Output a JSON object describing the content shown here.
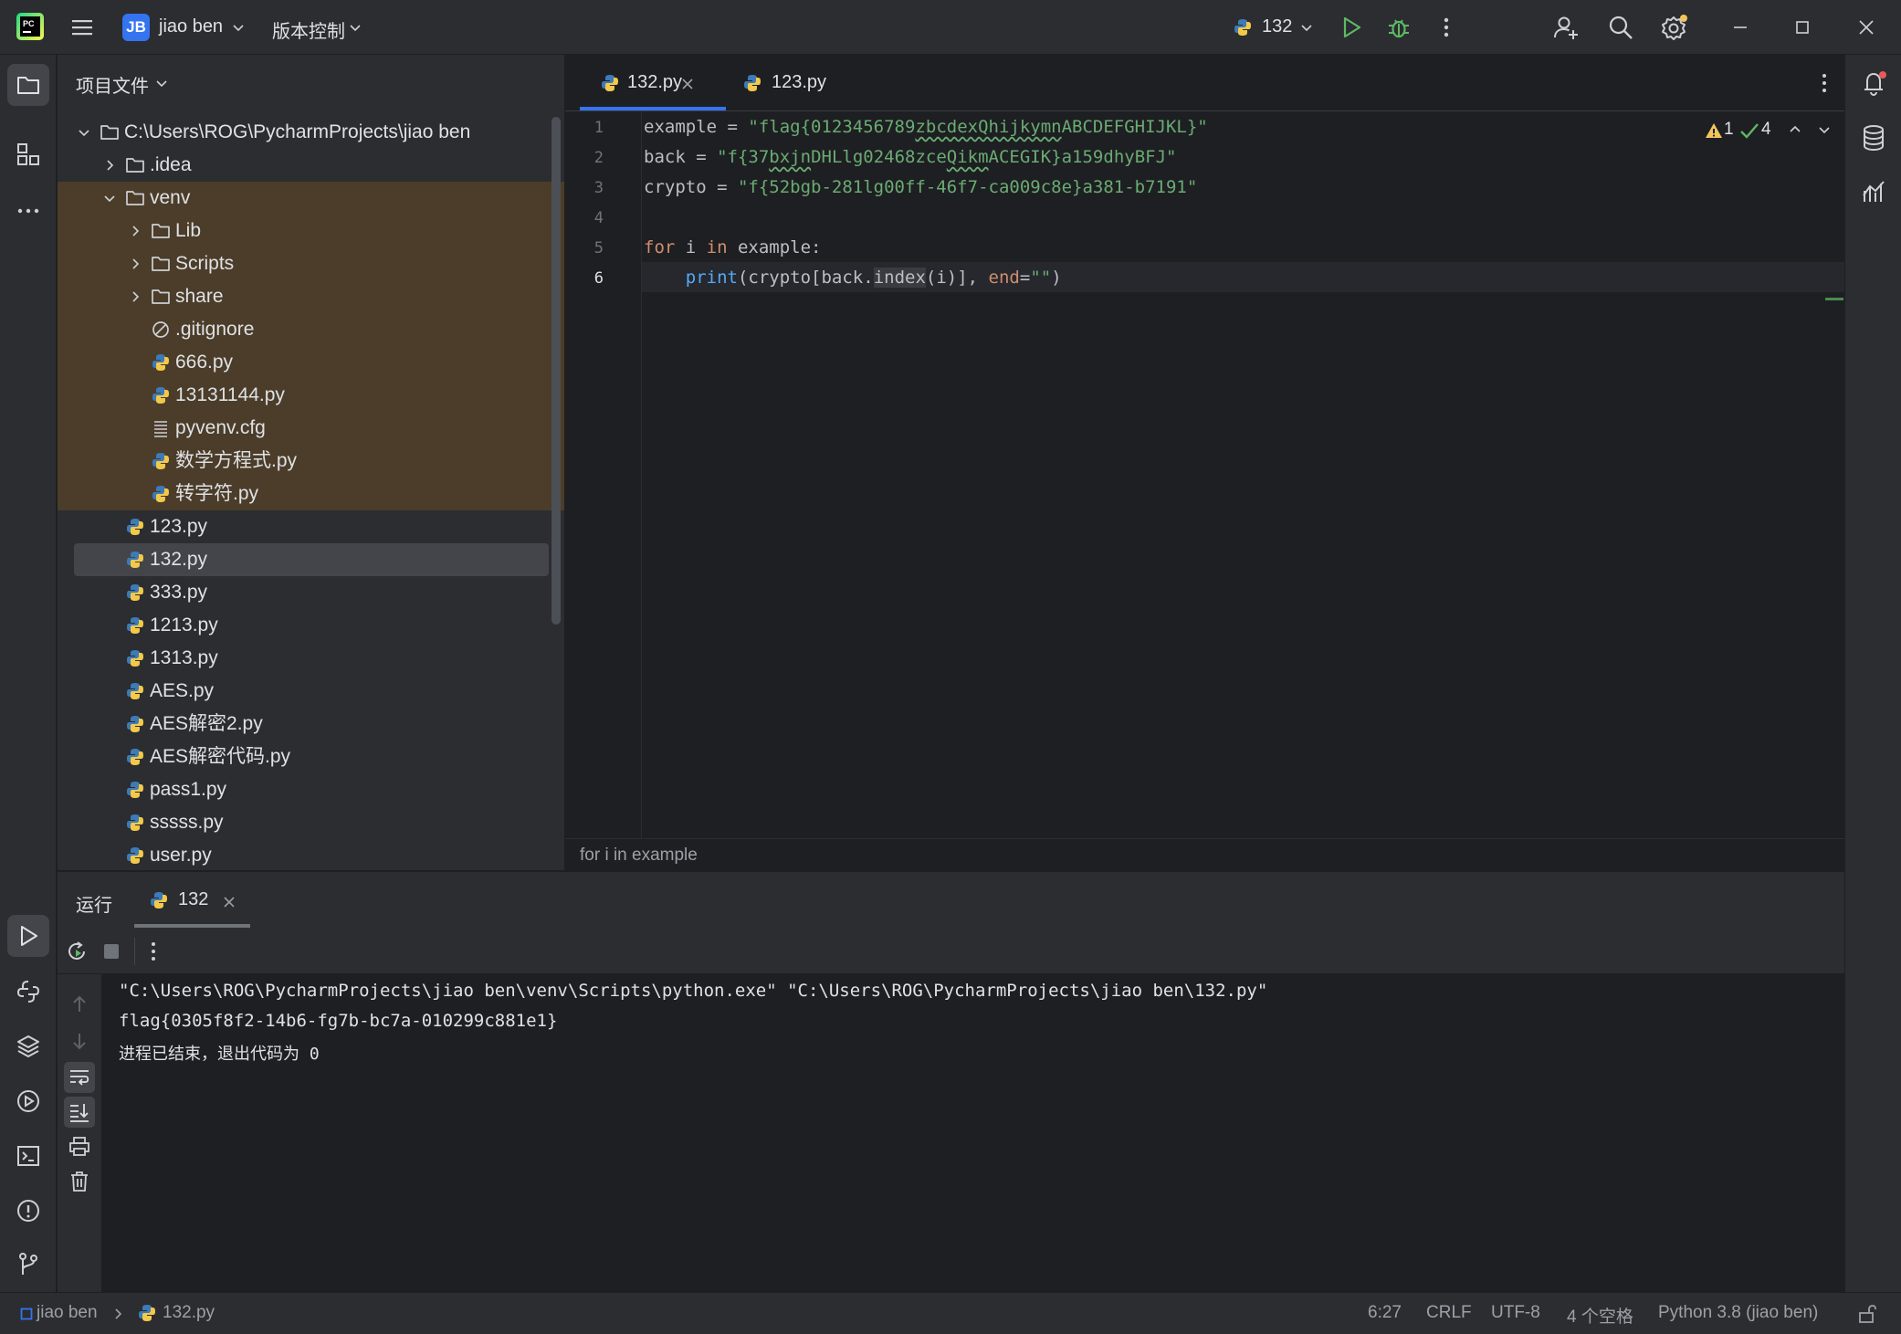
{
  "titlebar": {
    "project_badge": "JB",
    "project_name": "jiao ben",
    "vcs_label": "版本控制",
    "run_config": "132",
    "brand_color": "#3574f0"
  },
  "project_panel": {
    "title": "项目文件",
    "tree": [
      {
        "label": "C:\\Users\\ROG\\PycharmProjects\\jiao ben",
        "type": "folder",
        "depth": 0,
        "expanded": true
      },
      {
        "label": ".idea",
        "type": "folder",
        "depth": 1,
        "expanded": false
      },
      {
        "label": "venv",
        "type": "folder",
        "depth": 1,
        "expanded": true
      },
      {
        "label": "Lib",
        "type": "folder",
        "depth": 2,
        "expanded": false
      },
      {
        "label": "Scripts",
        "type": "folder",
        "depth": 2,
        "expanded": false
      },
      {
        "label": "share",
        "type": "folder",
        "depth": 2,
        "expanded": false
      },
      {
        "label": ".gitignore",
        "type": "ignore",
        "depth": 2
      },
      {
        "label": "666.py",
        "type": "python",
        "depth": 2
      },
      {
        "label": "13131144.py",
        "type": "python",
        "depth": 2
      },
      {
        "label": "pyvenv.cfg",
        "type": "text",
        "depth": 2
      },
      {
        "label": "数学方程式.py",
        "type": "python",
        "depth": 2
      },
      {
        "label": "转字符.py",
        "type": "python",
        "depth": 2
      },
      {
        "label": "123.py",
        "type": "python",
        "depth": 1
      },
      {
        "label": "132.py",
        "type": "python",
        "depth": 1,
        "selected": true
      },
      {
        "label": "333.py",
        "type": "python",
        "depth": 1
      },
      {
        "label": "1213.py",
        "type": "python",
        "depth": 1
      },
      {
        "label": "1313.py",
        "type": "python",
        "depth": 1
      },
      {
        "label": "AES.py",
        "type": "python",
        "depth": 1
      },
      {
        "label": "AES解密2.py",
        "type": "python",
        "depth": 1
      },
      {
        "label": "AES解密代码.py",
        "type": "python",
        "depth": 1
      },
      {
        "label": "pass1.py",
        "type": "python",
        "depth": 1
      },
      {
        "label": "sssss.py",
        "type": "python",
        "depth": 1
      },
      {
        "label": "user.py",
        "type": "python",
        "depth": 1
      }
    ]
  },
  "editor": {
    "tabs": [
      {
        "label": "132.py",
        "active": true
      },
      {
        "label": "123.py",
        "active": false
      }
    ],
    "inspections": {
      "warnings": "1",
      "ok": "4"
    },
    "line_numbers": [
      "1",
      "2",
      "3",
      "4",
      "5",
      "6"
    ],
    "code": {
      "l1_var": "example",
      "l1_eq": " = ",
      "l1_str_a": "\"flag{0123456789",
      "l1_str_b": "zbcdexQhijkymn",
      "l1_str_c": "ABCDEFGHIJKL}\"",
      "l2_var": "back",
      "l2_eq": " = ",
      "l2_str_a": "\"f{37",
      "l2_str_b": "bxjn",
      "l2_str_c": "DHLlg02468zce",
      "l2_str_d": "Qikm",
      "l2_str_e": "ACEGIK}a159dhyBFJ\"",
      "l3_var": "crypto",
      "l3_eq": " = ",
      "l3_str": "\"f{52bgb-281lg00ff-46f7-ca009c8e}a381-b7191\"",
      "l5_for": "for",
      "l5_i": " i ",
      "l5_in": "in",
      "l5_rest": " example:",
      "l6_indent": "    ",
      "l6_print": "print",
      "l6_a": "(crypto[back.",
      "l6_index": "index",
      "l6_b": "(i)], ",
      "l6_end": "end",
      "l6_eq": "=",
      "l6_str": "\"\"",
      "l6_close": ")"
    },
    "breadcrumb": "for i in example"
  },
  "run_panel": {
    "label": "运行",
    "tab": "132",
    "output": [
      "\"C:\\Users\\ROG\\PycharmProjects\\jiao ben\\venv\\Scripts\\python.exe\" \"C:\\Users\\ROG\\PycharmProjects\\jiao ben\\132.py\"",
      "flag{0305f8f2-14b6-fg7b-bc7a-010299c881e1}",
      "进程已结束，退出代码为 0"
    ]
  },
  "statusbar": {
    "project": "jiao ben",
    "file": "132.py",
    "position": "6:27",
    "line_sep": "CRLF",
    "encoding": "UTF-8",
    "indent": "4 个空格",
    "interpreter": "Python 3.8 (jiao ben)"
  },
  "colors": {
    "background": "#1e1f22",
    "panel": "#2b2d30",
    "accent": "#3574f0",
    "string": "#6aab73",
    "keyword": "#cf8e6d",
    "function": "#56a8f5",
    "run_green": "#5fb865",
    "venv_highlight": "#4b3d29"
  }
}
